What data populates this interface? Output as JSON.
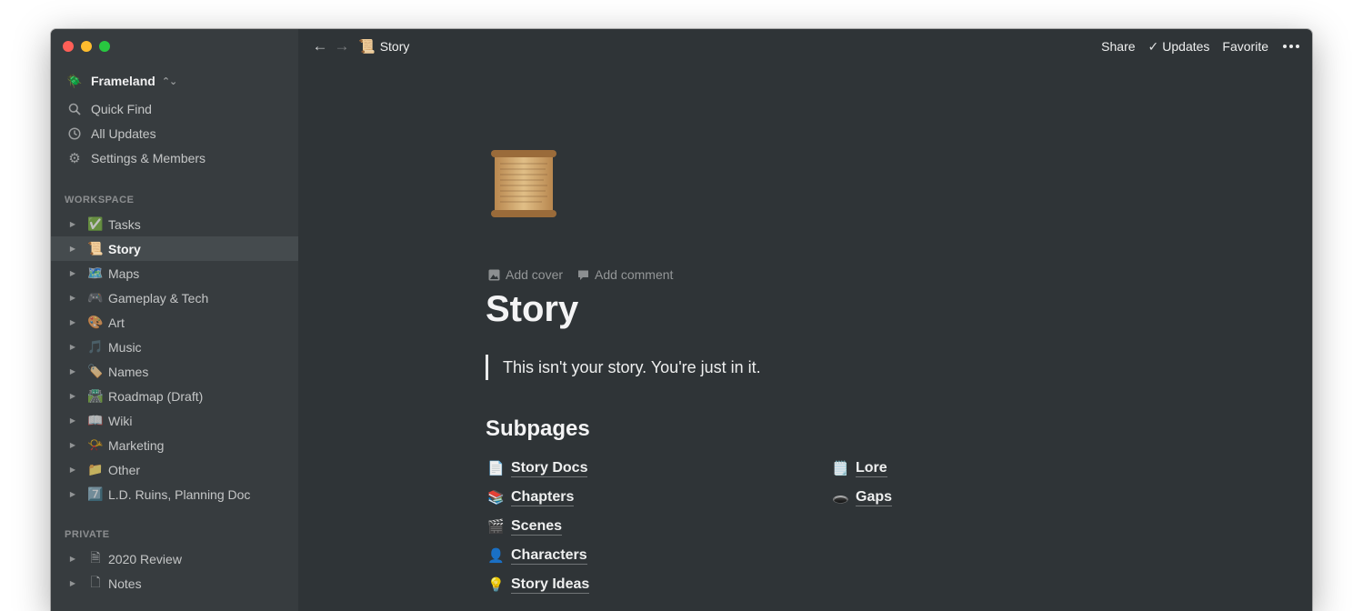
{
  "window": {
    "breadcrumb": {
      "icon": "scroll-icon",
      "emoji": "📜",
      "label": "Story"
    }
  },
  "sidebar": {
    "workspace": {
      "emoji": "🪲",
      "name": "Frameland"
    },
    "nav": [
      {
        "icon": "search-icon",
        "label": "Quick Find"
      },
      {
        "icon": "clock-icon",
        "label": "All Updates"
      },
      {
        "icon": "gear-icon",
        "label": "Settings & Members"
      }
    ],
    "workspace_label": "WORKSPACE",
    "workspace_items": [
      {
        "emoji": "✅",
        "label": "Tasks"
      },
      {
        "emoji": "📜",
        "label": "Story"
      },
      {
        "emoji": "🗺️",
        "label": "Maps"
      },
      {
        "emoji": "🎮",
        "label": "Gameplay & Tech"
      },
      {
        "emoji": "🎨",
        "label": "Art"
      },
      {
        "emoji": "🎵",
        "label": "Music"
      },
      {
        "emoji": "🏷️",
        "label": "Names"
      },
      {
        "emoji": "🛣️",
        "label": "Roadmap (Draft)"
      },
      {
        "emoji": "📖",
        "label": "Wiki"
      },
      {
        "emoji": "📯",
        "label": "Marketing"
      },
      {
        "emoji": "📁",
        "label": "Other"
      },
      {
        "emoji": "7️⃣",
        "label": "L.D. Ruins, Planning Doc"
      }
    ],
    "private_label": "PRIVATE",
    "private_items": [
      {
        "emoji": "🗎",
        "label": "2020 Review"
      },
      {
        "emoji": "🗋",
        "label": "Notes"
      }
    ]
  },
  "topbar": {
    "share": "Share",
    "updates": "Updates",
    "favorite": "Favorite"
  },
  "page": {
    "tools": {
      "add_cover": "Add cover",
      "add_comment": "Add comment"
    },
    "title": "Story",
    "quote": "This isn't your story. You're just in it.",
    "subheading": "Subpages",
    "subpages_left": [
      {
        "emoji": "📄",
        "label": "Story Docs"
      },
      {
        "emoji": "📚",
        "label": "Chapters"
      },
      {
        "emoji": "🎬",
        "label": "Scenes"
      },
      {
        "emoji": "👤",
        "label": "Characters"
      },
      {
        "emoji": "💡",
        "label": "Story Ideas"
      }
    ],
    "subpages_right": [
      {
        "emoji": "🗒️",
        "label": "Lore"
      },
      {
        "emoji": "🕳️",
        "label": "Gaps"
      }
    ]
  }
}
